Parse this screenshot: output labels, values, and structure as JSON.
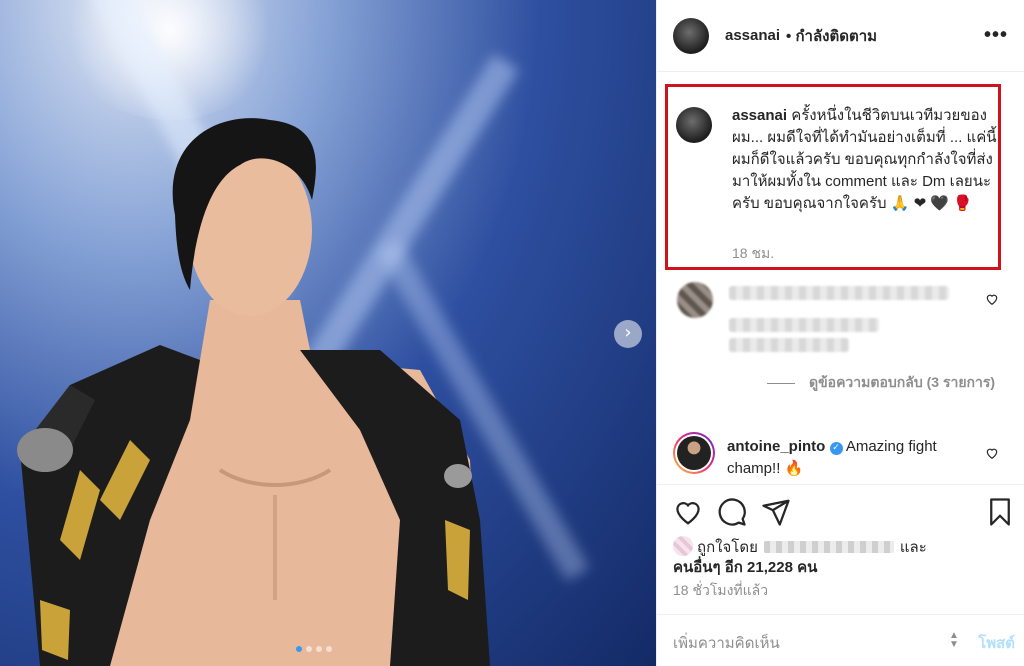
{
  "post": {
    "author": "assanai",
    "follow_status": "• กำลังติดตาม",
    "more_label": "•••"
  },
  "caption": {
    "username": "assanai",
    "text": "ครั้งหนึ่งในชีวิตบนเวทีมวยของผม... ผมดีใจที่ได้ทำมันอย่างเต็มที่ ... แค่นี้ผมก็ดีใจแล้วครับ ขอบคุณทุกกำลังใจที่ส่งมาให้ผมทั้งใน comment และ Dm เลยนะครับ ขอบคุณจากใจครับ",
    "emojis": "🙏 ❤ 🖤 🥊",
    "time": "18 ชม."
  },
  "replies": {
    "label": "ดูข้อความตอบกลับ (3 รายการ)"
  },
  "comment2": {
    "username": "antoine_pinto",
    "text": "Amazing fight champ!! 🔥"
  },
  "likes": {
    "prefix": "ถูกใจโดย",
    "and_label": "และ",
    "others": "คนอื่นๆ อีก 21,228 คน"
  },
  "timestamp": "18 ชั่วโมงที่แล้ว",
  "add_comment": {
    "placeholder": "เพิ่มความคิดเห็น",
    "post_label": "โพสต์"
  },
  "carousel": {
    "next_label": "›",
    "dot_count": 4,
    "active_dot": 1
  },
  "colors": {
    "highlight_box": "#d0121b",
    "link_blue": "#3897f0",
    "muted": "#8e8e8e"
  }
}
